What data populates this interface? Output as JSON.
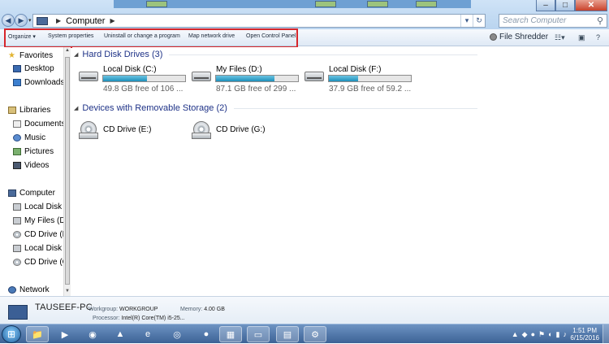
{
  "window": {
    "address": {
      "crumb": "Computer"
    },
    "search_placeholder": "Search Computer",
    "controls": {
      "minimize": "–",
      "maximize": "□",
      "close": "✕"
    }
  },
  "toolbar": {
    "organize": "Organize ▾",
    "system_properties": "System properties",
    "uninstall": "Uninstall or change a program",
    "map_drive": "Map network drive",
    "control_panel": "Open Control Panel",
    "file_shredder": "File Shredder",
    "highlight_color": "#d7262b"
  },
  "nav": {
    "favorites": "Favorites",
    "desktop": "Desktop",
    "downloads": "Downloads",
    "libraries": "Libraries",
    "documents": "Documents",
    "music": "Music",
    "pictures": "Pictures",
    "videos": "Videos",
    "computer": "Computer",
    "local_disk_1": "Local Disk",
    "my_files": "My Files (D",
    "cd_drive_1": "CD Drive (E",
    "local_disk_2": "Local Disk",
    "cd_drive_2": "CD Drive (G"
  },
  "network": "Network",
  "groups": {
    "hard_disks": "Hard Disk Drives (3)",
    "removable": "Devices with Removable Storage (2)"
  },
  "drives": [
    {
      "name": "Local Disk (C:)",
      "free": "49.8 GB free of 106 ...",
      "used_fraction": 0.53
    },
    {
      "name": "My Files (D:)",
      "free": "87.1 GB free of 299 ...",
      "used_fraction": 0.71
    },
    {
      "name": "Local Disk (F:)",
      "free": "37.9 GB free of 59.2 ...",
      "used_fraction": 0.36
    }
  ],
  "removable": [
    {
      "name": "CD Drive (E:)"
    },
    {
      "name": "CD Drive (G:)"
    }
  ],
  "details": {
    "pc_name": "TAUSEEF-PC",
    "workgroup_label": "Workgroup:",
    "workgroup": "WORKGROUP",
    "memory_label": "Memory:",
    "memory": "4.00 GB",
    "processor_label": "Processor:",
    "processor": "Intel(R) Core(TM) i5-25..."
  },
  "taskbar": {
    "time": "1:51 PM",
    "date": "6/15/2016",
    "apps": [
      "explorer-icon",
      "media-player-icon",
      "chrome-icon",
      "vlc-icon",
      "ie-icon",
      "wifi-app-icon",
      "red-app-icon",
      "network-app-icon",
      "window-icon",
      "winrar-icon",
      "settings-gear-icon"
    ]
  }
}
